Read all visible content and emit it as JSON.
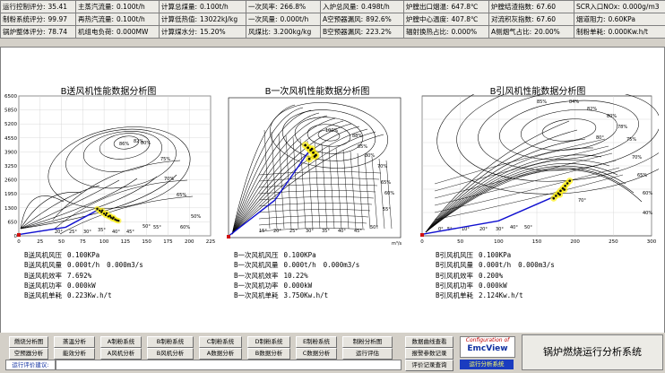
{
  "stats": [
    [
      [
        "运行控制评分:",
        "35.41"
      ],
      [
        "主蒸汽流量:",
        "0.100t/h"
      ],
      [
        "计算总煤量:",
        "0.100t/h"
      ],
      [
        "一次风率:",
        "266.8%"
      ],
      [
        "入炉总风量:",
        "0.498t/h"
      ],
      [
        "炉膛出口烟温:",
        "647.8℃"
      ],
      [
        "炉膛结渣指数:",
        "67.60"
      ],
      [
        "SCR入口NOx:",
        "0.000g/m3"
      ]
    ],
    [
      [
        "制粉系统评分:",
        "99.97"
      ],
      [
        "再热汽流量:",
        "0.100t/h"
      ],
      [
        "计算低热值:",
        "13022kJ/kg"
      ],
      [
        "一次风量:",
        "0.000t/h"
      ],
      [
        "A空预器漏风:",
        "892.6%"
      ],
      [
        "炉膛中心温度:",
        "407.8℃"
      ],
      [
        "对流积灰指数:",
        "67.60"
      ],
      [
        "烟道阻力:",
        "0.60KPa"
      ]
    ],
    [
      [
        "锅炉整体评分:",
        "78.74"
      ],
      [
        "机组电负荷:",
        "0.000MW"
      ],
      [
        "计算煤水分:",
        "15.20%"
      ],
      [
        "风煤比:",
        "3.200kg/kg"
      ],
      [
        "B空预器漏风:",
        "223.2%"
      ],
      [
        "辐射换热占比:",
        "0.000%"
      ],
      [
        "A侧烟气占比:",
        "20.00%"
      ],
      [
        "制粉单耗:",
        "0.000Kw.h/t"
      ]
    ]
  ],
  "fan_charts": [
    {
      "title": "B送风机性能数据分析图",
      "info": [
        [
          "B送风机风压",
          "0.100KPa"
        ],
        [
          "B送风机风量",
          "0.000t/h",
          "0.000m3/s"
        ],
        [
          "B送风机效率",
          "7.692%"
        ],
        [
          "B送风机功率",
          "0.000kW"
        ],
        [
          "B送风机单耗",
          "0.223Kw.h/t"
        ]
      ]
    },
    {
      "title": "B一次风机性能数据分析图",
      "info": [
        [
          "B一次风机风压",
          "0.100KPa"
        ],
        [
          "B一次风机风量",
          "0.000t/h",
          "0.000m3/s"
        ],
        [
          "B一次风机效率",
          "10.22%"
        ],
        [
          "B一次风机功率",
          "0.000kW"
        ],
        [
          "B一次风机单耗",
          "3.750Kw.h/t"
        ]
      ]
    },
    {
      "title": "B引风机性能数据分析图",
      "info": [
        [
          "B引风机风压",
          "0.100KPa"
        ],
        [
          "B引风机风量",
          "0.000t/h",
          "0.000m3/s"
        ],
        [
          "B引风机效率",
          "0.200%"
        ],
        [
          "B引风机功率",
          "0.000kW"
        ],
        [
          "B引风机单耗",
          "2.124Kw.h/t"
        ]
      ]
    }
  ],
  "chart_data": [
    {
      "type": "line",
      "title": "B送风机性能数据分析图",
      "xlim": [
        0,
        225
      ],
      "ylim": [
        0,
        6500
      ],
      "x_ticks": [
        0,
        25,
        50,
        75,
        100,
        125,
        150,
        175,
        200,
        225
      ],
      "y_ticks": [
        0,
        650,
        1300,
        1950,
        2600,
        3250,
        3900,
        4550,
        5200,
        5850,
        6500
      ],
      "x_tick_labels": [
        "0",
        "25",
        "50",
        "75",
        "100",
        "125",
        "150",
        "175",
        "200",
        "225"
      ],
      "y_tick_labels": [
        "0",
        "650",
        "1300",
        "1950",
        "2600",
        "3250",
        "3900",
        "4550",
        "5200",
        "5850",
        "6500"
      ],
      "contour_labels": [
        "86%",
        "82%",
        "80%",
        "75%",
        "70%",
        "65%",
        "60%",
        "50%",
        "55°",
        "50°",
        "45°",
        "40°",
        "35°",
        "30°",
        "25°",
        "20°"
      ],
      "cluster": [
        {
          "x": 92,
          "y": 1250
        },
        {
          "x": 95,
          "y": 1170
        },
        {
          "x": 97,
          "y": 1100
        },
        {
          "x": 100,
          "y": 1030
        },
        {
          "x": 102,
          "y": 960
        },
        {
          "x": 105,
          "y": 900
        },
        {
          "x": 108,
          "y": 850
        },
        {
          "x": 110,
          "y": 800
        },
        {
          "x": 113,
          "y": 760
        },
        {
          "x": 115,
          "y": 720
        },
        {
          "x": 98,
          "y": 1180
        },
        {
          "x": 103,
          "y": 1050
        },
        {
          "x": 107,
          "y": 930
        },
        {
          "x": 111,
          "y": 850
        },
        {
          "x": 117,
          "y": 700
        }
      ],
      "operating_line": [
        {
          "x": 0,
          "y": 60
        },
        {
          "x": 55,
          "y": 400
        },
        {
          "x": 95,
          "y": 1250
        }
      ]
    },
    {
      "type": "line",
      "title": "B一次风机性能数据分析图",
      "x_unit": "m³/s",
      "contour_labels": [
        "100%",
        "88%",
        "85%",
        "80%",
        "70%",
        "65%",
        "60%",
        "55°",
        "50°",
        "45°",
        "40°",
        "35°",
        "30°",
        "25°",
        "20°",
        "15°"
      ],
      "cluster": [
        {
          "x": 60,
          "y": 3600
        },
        {
          "x": 62,
          "y": 3500
        },
        {
          "x": 64,
          "y": 3400
        },
        {
          "x": 66,
          "y": 3300
        },
        {
          "x": 58,
          "y": 3700
        },
        {
          "x": 63,
          "y": 3550
        },
        {
          "x": 65,
          "y": 3250
        },
        {
          "x": 61,
          "y": 3150
        }
      ],
      "operating_line": [
        {
          "x": 0,
          "y": 60
        },
        {
          "x": 35,
          "y": 1500
        },
        {
          "x": 60,
          "y": 3400
        }
      ]
    },
    {
      "type": "line",
      "title": "B引风机性能数据分析图",
      "xlim": [
        0,
        300
      ],
      "x_ticks": [
        0,
        50,
        100,
        150,
        200,
        250,
        300
      ],
      "x_tick_labels": [
        "0",
        "50",
        "100",
        "150",
        "200",
        "250",
        "300"
      ],
      "contour_labels": [
        "85%",
        "84%",
        "82%",
        "80%",
        "78%",
        "75%",
        "70%",
        "65%",
        "60%",
        "40%",
        "80°",
        "70°",
        "50°",
        "40°",
        "30°",
        "20°",
        "10°",
        "5°",
        "0°"
      ],
      "cluster": [
        {
          "x": 175,
          "y": 1600
        },
        {
          "x": 178,
          "y": 1700
        },
        {
          "x": 181,
          "y": 1800
        },
        {
          "x": 184,
          "y": 1900
        },
        {
          "x": 187,
          "y": 2000
        },
        {
          "x": 190,
          "y": 2100
        },
        {
          "x": 193,
          "y": 2200
        },
        {
          "x": 172,
          "y": 1500
        },
        {
          "x": 180,
          "y": 1650
        },
        {
          "x": 186,
          "y": 1850
        }
      ],
      "operating_line": [
        {
          "x": 0,
          "y": 60
        },
        {
          "x": 100,
          "y": 600
        },
        {
          "x": 175,
          "y": 1600
        }
      ]
    }
  ],
  "buttons": {
    "row1": [
      "燃烧分析图",
      "蒸温分析",
      "A制粉系统",
      "B制粉系统",
      "C制粉系统",
      "D制粉系统",
      "E制粉系统",
      "制粉分析图",
      "数据曲线查看"
    ],
    "row2": [
      "空预器分析",
      "能效分析",
      "A风机分析",
      "B风机分析",
      "A数据分析",
      "B数据分析",
      "C数据分析",
      "运行评估",
      "报警参数记录"
    ],
    "row3_right": "评价记录查询"
  },
  "tip_label": "运行评价建议:",
  "logo": {
    "config": "Configuration of",
    "name": "EmcView",
    "bottom": "运行分析系统"
  },
  "system_title": "锅炉燃烧运行分析系统",
  "colors": {
    "point": "#0a0a0a",
    "halo": "#ffee00",
    "line": "#1010d0",
    "curve": "#000000",
    "marker": "#d01010"
  }
}
